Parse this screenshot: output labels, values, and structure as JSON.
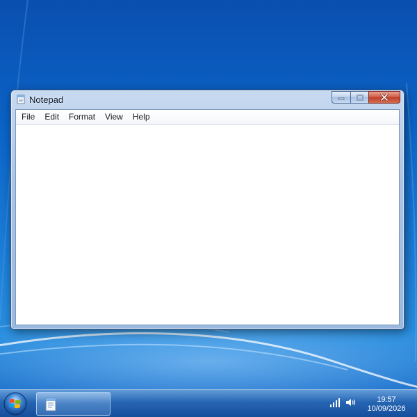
{
  "window": {
    "title": "Notepad",
    "app_icon": "notepad-icon",
    "caption_buttons": {
      "minimize": "minimize-icon",
      "maximize": "maximize-icon",
      "close": "close-icon"
    },
    "content_text": ""
  },
  "menubar": {
    "items": [
      {
        "label": "File"
      },
      {
        "label": "Edit"
      },
      {
        "label": "Format"
      },
      {
        "label": "View"
      },
      {
        "label": "Help"
      }
    ]
  },
  "taskbar": {
    "start_icon": "windows-logo-icon",
    "tasks": [
      {
        "icon": "notepad-icon",
        "active": true
      }
    ],
    "tray": {
      "icons": [
        "network-signal-icon",
        "volume-icon"
      ],
      "time": "19:57",
      "date": "10/09/2026"
    }
  },
  "colors": {
    "desktop_blue": "#0b63c7",
    "close_button_red": "#c0412b",
    "window_frame": "#a9c4e6"
  }
}
